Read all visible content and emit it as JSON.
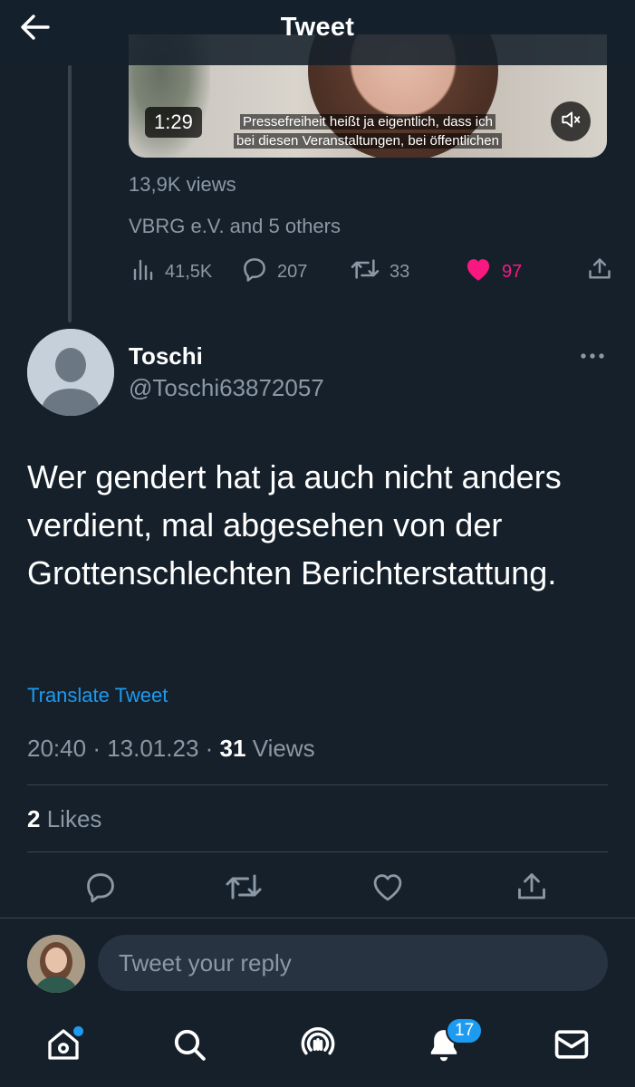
{
  "header": {
    "title": "Tweet"
  },
  "parent_tweet": {
    "video": {
      "timer": "1:29",
      "subtitle_line1": "Pressefreiheit heißt ja eigentlich, dass ich",
      "subtitle_line2": "bei diesen Veranstaltungen, bei öffentlichen"
    },
    "views": "13,9K views",
    "liked_by": "VBRG e.V. and 5 others",
    "actions": {
      "analytics": "41,5K",
      "replies": "207",
      "retweets": "33",
      "likes": "97"
    },
    "colors": {
      "like_active": "#f91880"
    }
  },
  "tweet": {
    "name": "Toschi",
    "handle": "@Toschi63872057",
    "text": "Wer gendert hat ja auch nicht anders verdient, mal abgesehen von der Grottenschlechten Berichterstattung.",
    "translate_label": "Translate Tweet",
    "time": "20:40",
    "date": "13.01.23",
    "views_count": "31",
    "views_label": "Views",
    "likes_count": "2",
    "likes_label": "Likes"
  },
  "reply": {
    "placeholder": "Tweet your reply"
  },
  "nav": {
    "notifications_badge": "17",
    "items": [
      "home-icon",
      "search-icon",
      "spaces-icon",
      "bell-icon",
      "mail-icon"
    ]
  },
  "colors": {
    "background": "#15202b",
    "accent": "#1d9bf0",
    "secondary_text": "#8b98a5",
    "divider": "#38444d"
  }
}
